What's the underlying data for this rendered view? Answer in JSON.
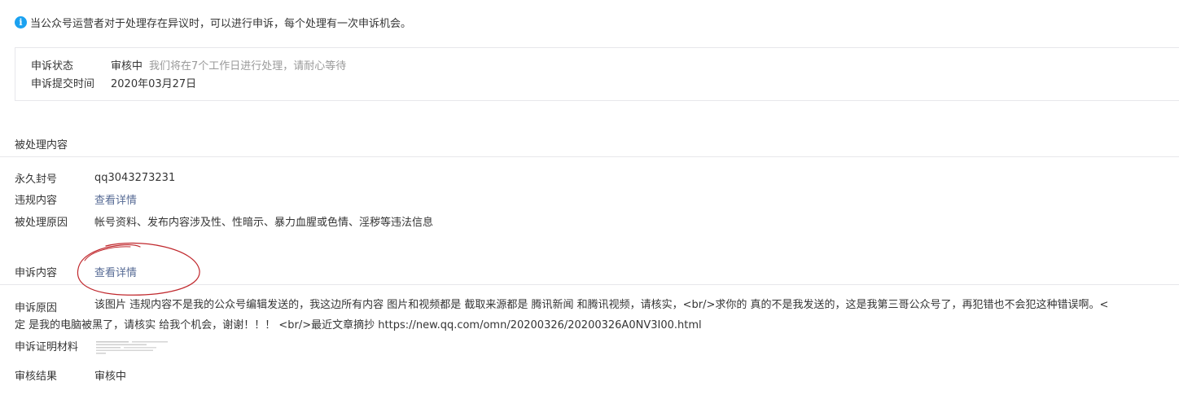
{
  "notice": {
    "icon": "info-icon",
    "text": "当公众号运营者对于处理存在异议时，可以进行申诉，每个处理有一次申诉机会。"
  },
  "status": {
    "state_label": "申诉状态",
    "state_value": "审核中",
    "state_hint": "我们将在7个工作日进行处理，请耐心等待",
    "submit_label": "申诉提交时间",
    "submit_value": "2020年03月27日"
  },
  "handled": {
    "title": "被处理内容",
    "ban_label": "永久封号",
    "ban_value": "qq3043273231",
    "violation_label": "违规内容",
    "violation_link": "查看详情",
    "reason_label": "被处理原因",
    "reason_value": "帐号资料、发布内容涉及性、性暗示、暴力血腥或色情、淫秽等违法信息"
  },
  "appeal": {
    "content_label": "申诉内容",
    "content_link": "查看详情",
    "reason_label": "申诉原因",
    "reason_line1": "该图片 违规内容不是我的公众号编辑发送的，我这边所有内容 图片和视频都是 截取来源都是 腾讯新闻 和腾讯视频，请核实，<br/>求你的 真的不是我发送的，这是我第三哥公众号了，再犯错也不会犯这种错误啊。<",
    "reason_line2": "定 是我的电脑被黑了，请核实 给我个机会，谢谢！！！ <br/>最近文章摘抄 https://new.qq.com/omn/20200326/20200326A0NV3I00.html",
    "evidence_label": "申诉证明材料",
    "result_label": "审核结果",
    "result_value": "审核中"
  },
  "colors": {
    "link": "#576b95",
    "info_icon": "#1aa1f0",
    "annotation": "#c0282d",
    "divider": "#e7e7eb"
  }
}
